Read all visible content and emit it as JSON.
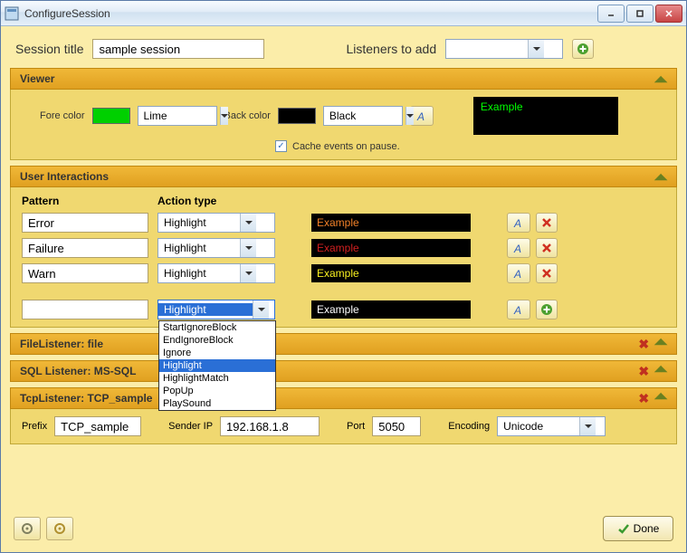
{
  "window": {
    "title": "ConfigureSession"
  },
  "top": {
    "session_title_label": "Session title",
    "session_title_value": "sample session",
    "listeners_label": "Listeners to add",
    "listeners_value": ""
  },
  "viewer": {
    "header": "Viewer",
    "fore_label": "Fore color",
    "fore_value": "Lime",
    "fore_swatch": "#00d000",
    "back_label": "Back color",
    "back_value": "Black",
    "back_swatch": "#000000",
    "cache_label": "Cache events on pause.",
    "cache_checked": true,
    "example_text": "Example",
    "example_color": "#00ff00"
  },
  "interactions": {
    "header": "User Interactions",
    "col_pattern": "Pattern",
    "col_action": "Action type",
    "rows": [
      {
        "pattern": "Error",
        "action": "Highlight",
        "example": "Example",
        "example_color": "#f08028"
      },
      {
        "pattern": "Failure",
        "action": "Highlight",
        "example": "Example",
        "example_color": "#d02020"
      },
      {
        "pattern": "Warn",
        "action": "Highlight",
        "example": "Example",
        "example_color": "#f8f020"
      }
    ],
    "new_row": {
      "pattern": "",
      "action": "Highlight",
      "example": "Example",
      "example_color": "#ffffff",
      "dropdown_open": true,
      "options": [
        "StartIgnoreBlock",
        "EndIgnoreBlock",
        "Ignore",
        "Highlight",
        "HighlightMatch",
        "PopUp",
        "PlaySound"
      ],
      "selected_option": "Highlight"
    }
  },
  "file_listener": {
    "header": "FileListener: file"
  },
  "sql_listener": {
    "header": "SQL Listener: MS-SQL"
  },
  "tcp_listener": {
    "header": "TcpListener: TCP_sample",
    "prefix_label": "Prefix",
    "prefix_value": "TCP_sample",
    "ip_label": "Sender IP",
    "ip_value": "192.168.1.8",
    "port_label": "Port",
    "port_value": "5050",
    "encoding_label": "Encoding",
    "encoding_value": "Unicode"
  },
  "footer": {
    "done_label": "Done"
  },
  "icons": {
    "add": "plus-circle-icon",
    "delete": "delete-x-icon",
    "font": "font-a-icon",
    "gear": "gear-icon",
    "check": "check-icon"
  }
}
